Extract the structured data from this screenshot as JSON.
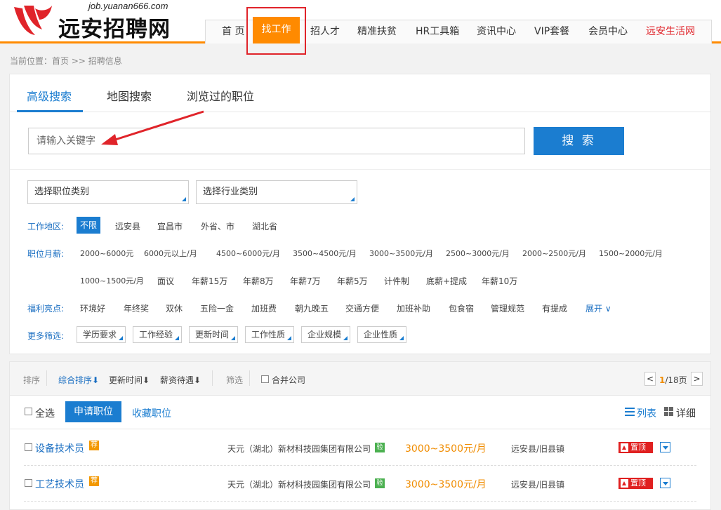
{
  "header": {
    "domain": "job.yuanan666.com",
    "site_name": "远安招聘网",
    "nav": [
      "首 页",
      "找工作",
      "招人才",
      "精准扶贫",
      "HR工具箱",
      "资讯中心",
      "VIP套餐",
      "会员中心",
      "远安生活网"
    ],
    "nav_active_index": 1
  },
  "breadcrumb": "当前位置：首页 >> 招聘信息",
  "search_tabs": [
    "高级搜索",
    "地图搜索",
    "浏览过的职位"
  ],
  "search": {
    "placeholder": "请输入关键字",
    "button": "搜 索"
  },
  "selects": [
    "选择职位类别",
    "选择行业类别"
  ],
  "filters": {
    "area": {
      "label": "工作地区:",
      "options": [
        "不限",
        "远安县",
        "宜昌市",
        "外省、市",
        "湖北省"
      ],
      "active": "不限"
    },
    "salary": {
      "label": "职位月薪:",
      "options_row1": [
        "2000~6000元",
        "6000元以上/月",
        "4500~6000元/月",
        "3500~4500元/月",
        "3000~3500元/月",
        "2500~3000元/月",
        "2000~2500元/月",
        "1500~2000元/月"
      ],
      "options_row2": [
        "1000~1500元/月",
        "面议",
        "年薪15万",
        "年薪8万",
        "年薪7万",
        "年薪5万",
        "计件制",
        "底薪+提成",
        "年薪10万"
      ]
    },
    "welfare": {
      "label": "福利亮点:",
      "options": [
        "环境好",
        "年终奖",
        "双休",
        "五险一金",
        "加班费",
        "朝九晚五",
        "交通方便",
        "加班补助",
        "包食宿",
        "管理规范",
        "有提成"
      ],
      "expand": "展开"
    },
    "more": {
      "label": "更多筛选:",
      "options": [
        "学历要求",
        "工作经验",
        "更新时间",
        "工作性质",
        "企业规模",
        "企业性质"
      ]
    }
  },
  "sortbar": {
    "sort_label": "排序",
    "sorts": [
      "综合排序⬇",
      "更新时间⬇",
      "薪资待遇⬇"
    ],
    "filter_label": "筛选",
    "merge": "合并公司",
    "pager": {
      "prev": "<",
      "current": "1",
      "total": "/18页",
      "next": ">"
    }
  },
  "list_actions": {
    "select_all": "全选",
    "apply": "申请职位",
    "favorite": "收藏职位",
    "view_list": "列表",
    "view_detail": "详细"
  },
  "jobs": [
    {
      "title": "设备技术员",
      "rec": "荐",
      "company": "天元（湖北）新材科技园集团有限公司",
      "verified": "验",
      "salary": "3000~3500元/月",
      "location": "远安县/旧县镇",
      "top": "置顶"
    },
    {
      "title": "工艺技术员",
      "rec": "荐",
      "company": "天元（湖北）新材科技园集团有限公司",
      "verified": "验",
      "salary": "3000~3500元/月",
      "location": "远安县/旧县镇",
      "top": "置顶"
    }
  ],
  "colors": {
    "brand_orange": "#ff8a00",
    "primary_blue": "#1b7dd0",
    "highlight_red": "#e0242a",
    "salary_orange": "#f08c00"
  }
}
